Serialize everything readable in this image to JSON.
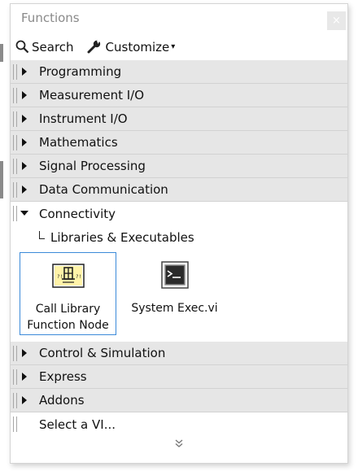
{
  "window": {
    "title": "Functions",
    "close_glyph": "×"
  },
  "toolbar": {
    "search_label": "Search",
    "customize_label": "Customize",
    "customize_caret": "▾"
  },
  "categories_top": [
    {
      "label": "Programming",
      "expanded": false
    },
    {
      "label": "Measurement I/O",
      "expanded": false
    },
    {
      "label": "Instrument I/O",
      "expanded": false
    },
    {
      "label": "Mathematics",
      "expanded": false
    },
    {
      "label": "Signal Processing",
      "expanded": false
    },
    {
      "label": "Data Communication",
      "expanded": false
    }
  ],
  "open_category": {
    "label": "Connectivity",
    "expanded": true,
    "subpath": "Libraries & Executables",
    "items": [
      {
        "label_line1": "Call Library",
        "label_line2": "Function Node",
        "icon": "call-library-function-node-icon",
        "selected": true
      },
      {
        "label_line1": "System Exec.vi",
        "label_line2": "",
        "icon": "system-exec-icon",
        "selected": false
      }
    ]
  },
  "categories_bottom": [
    {
      "label": "Control & Simulation",
      "expanded": false
    },
    {
      "label": "Express",
      "expanded": false
    },
    {
      "label": "Addons",
      "expanded": false
    }
  ],
  "select_vi": "Select a VI...",
  "footer": {
    "more_glyph": "⌄⌄"
  },
  "colors": {
    "row_bg": "#e6e6e6",
    "selection_border": "#3b8ad9",
    "title_text": "#8a8a8a"
  }
}
